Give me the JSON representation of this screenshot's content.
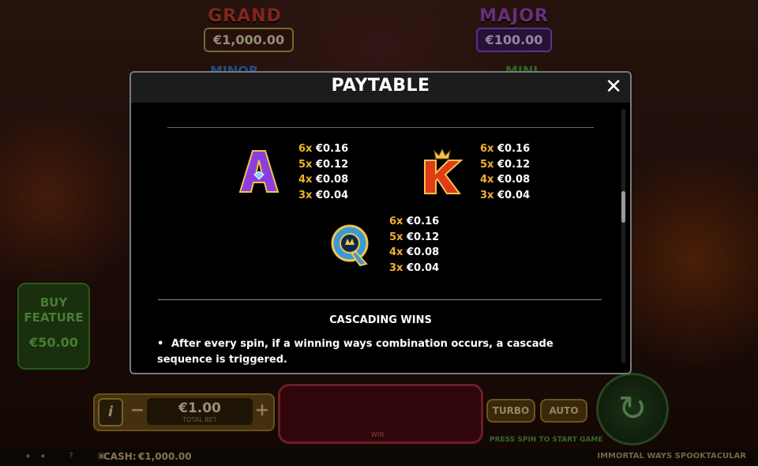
{
  "jackpots": {
    "grand": {
      "label": "GRAND",
      "value": "€1,000.00"
    },
    "major": {
      "label": "MAJOR",
      "value": "€100.00"
    },
    "minor": {
      "label": "MINOR"
    },
    "mini": {
      "label": "MINI"
    }
  },
  "buy_feature": {
    "label": "BUY FEATURE",
    "price": "€50.00"
  },
  "dialog": {
    "title": "PAYTABLE",
    "close_icon": "close-icon",
    "symbols": [
      {
        "name": "A",
        "color": "#8a3ee0",
        "gem": "diamond",
        "pays": [
          {
            "mult": "6x",
            "amount": "€0.16"
          },
          {
            "mult": "5x",
            "amount": "€0.12"
          },
          {
            "mult": "4x",
            "amount": "€0.08"
          },
          {
            "mult": "3x",
            "amount": "€0.04"
          }
        ]
      },
      {
        "name": "K",
        "color": "#e03a18",
        "gem": "crown",
        "pays": [
          {
            "mult": "6x",
            "amount": "€0.16"
          },
          {
            "mult": "5x",
            "amount": "€0.12"
          },
          {
            "mult": "4x",
            "amount": "€0.08"
          },
          {
            "mult": "3x",
            "amount": "€0.04"
          }
        ]
      },
      {
        "name": "Q",
        "color": "#3a9ad8",
        "gem": "crown",
        "pays": [
          {
            "mult": "6x",
            "amount": "€0.16"
          },
          {
            "mult": "5x",
            "amount": "€0.12"
          },
          {
            "mult": "4x",
            "amount": "€0.08"
          },
          {
            "mult": "3x",
            "amount": "€0.04"
          }
        ]
      }
    ],
    "section_title": "CASCADING WINS",
    "bullet_marker": "•",
    "bullet_text": "After every spin, if a winning ways combination occurs, a cascade sequence is triggered."
  },
  "controls": {
    "info_label": "i",
    "minus": "−",
    "plus": "+",
    "bet_value": "€1.00",
    "bet_label": "TOTAL BET",
    "win_label": "WIN",
    "turbo_label": "TURBO",
    "auto_label": "AUTO",
    "press_spin": "PRESS SPIN TO START GAME",
    "spin_icon": "↻"
  },
  "footer": {
    "cash_label": "CASH:",
    "cash_value": "€1,000.00",
    "game_name": "IMMORTAL WAYS SPOOKTACULAR",
    "sys_icons": "◂◂ ? ▣"
  }
}
